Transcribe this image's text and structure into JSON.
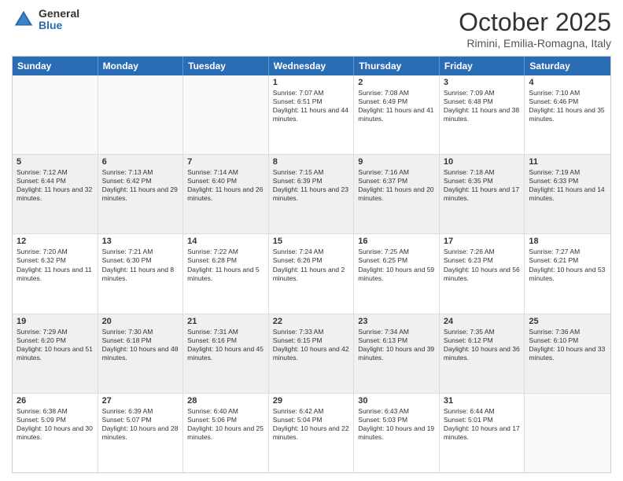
{
  "logo": {
    "general": "General",
    "blue": "Blue"
  },
  "header": {
    "month": "October 2025",
    "location": "Rimini, Emilia-Romagna, Italy"
  },
  "days": [
    "Sunday",
    "Monday",
    "Tuesday",
    "Wednesday",
    "Thursday",
    "Friday",
    "Saturday"
  ],
  "weeks": [
    [
      {
        "day": "",
        "content": ""
      },
      {
        "day": "",
        "content": ""
      },
      {
        "day": "",
        "content": ""
      },
      {
        "day": "1",
        "content": "Sunrise: 7:07 AM\nSunset: 6:51 PM\nDaylight: 11 hours and 44 minutes."
      },
      {
        "day": "2",
        "content": "Sunrise: 7:08 AM\nSunset: 6:49 PM\nDaylight: 11 hours and 41 minutes."
      },
      {
        "day": "3",
        "content": "Sunrise: 7:09 AM\nSunset: 6:48 PM\nDaylight: 11 hours and 38 minutes."
      },
      {
        "day": "4",
        "content": "Sunrise: 7:10 AM\nSunset: 6:46 PM\nDaylight: 11 hours and 35 minutes."
      }
    ],
    [
      {
        "day": "5",
        "content": "Sunrise: 7:12 AM\nSunset: 6:44 PM\nDaylight: 11 hours and 32 minutes."
      },
      {
        "day": "6",
        "content": "Sunrise: 7:13 AM\nSunset: 6:42 PM\nDaylight: 11 hours and 29 minutes."
      },
      {
        "day": "7",
        "content": "Sunrise: 7:14 AM\nSunset: 6:40 PM\nDaylight: 11 hours and 26 minutes."
      },
      {
        "day": "8",
        "content": "Sunrise: 7:15 AM\nSunset: 6:39 PM\nDaylight: 11 hours and 23 minutes."
      },
      {
        "day": "9",
        "content": "Sunrise: 7:16 AM\nSunset: 6:37 PM\nDaylight: 11 hours and 20 minutes."
      },
      {
        "day": "10",
        "content": "Sunrise: 7:18 AM\nSunset: 6:35 PM\nDaylight: 11 hours and 17 minutes."
      },
      {
        "day": "11",
        "content": "Sunrise: 7:19 AM\nSunset: 6:33 PM\nDaylight: 11 hours and 14 minutes."
      }
    ],
    [
      {
        "day": "12",
        "content": "Sunrise: 7:20 AM\nSunset: 6:32 PM\nDaylight: 11 hours and 11 minutes."
      },
      {
        "day": "13",
        "content": "Sunrise: 7:21 AM\nSunset: 6:30 PM\nDaylight: 11 hours and 8 minutes."
      },
      {
        "day": "14",
        "content": "Sunrise: 7:22 AM\nSunset: 6:28 PM\nDaylight: 11 hours and 5 minutes."
      },
      {
        "day": "15",
        "content": "Sunrise: 7:24 AM\nSunset: 6:26 PM\nDaylight: 11 hours and 2 minutes."
      },
      {
        "day": "16",
        "content": "Sunrise: 7:25 AM\nSunset: 6:25 PM\nDaylight: 10 hours and 59 minutes."
      },
      {
        "day": "17",
        "content": "Sunrise: 7:26 AM\nSunset: 6:23 PM\nDaylight: 10 hours and 56 minutes."
      },
      {
        "day": "18",
        "content": "Sunrise: 7:27 AM\nSunset: 6:21 PM\nDaylight: 10 hours and 53 minutes."
      }
    ],
    [
      {
        "day": "19",
        "content": "Sunrise: 7:29 AM\nSunset: 6:20 PM\nDaylight: 10 hours and 51 minutes."
      },
      {
        "day": "20",
        "content": "Sunrise: 7:30 AM\nSunset: 6:18 PM\nDaylight: 10 hours and 48 minutes."
      },
      {
        "day": "21",
        "content": "Sunrise: 7:31 AM\nSunset: 6:16 PM\nDaylight: 10 hours and 45 minutes."
      },
      {
        "day": "22",
        "content": "Sunrise: 7:33 AM\nSunset: 6:15 PM\nDaylight: 10 hours and 42 minutes."
      },
      {
        "day": "23",
        "content": "Sunrise: 7:34 AM\nSunset: 6:13 PM\nDaylight: 10 hours and 39 minutes."
      },
      {
        "day": "24",
        "content": "Sunrise: 7:35 AM\nSunset: 6:12 PM\nDaylight: 10 hours and 36 minutes."
      },
      {
        "day": "25",
        "content": "Sunrise: 7:36 AM\nSunset: 6:10 PM\nDaylight: 10 hours and 33 minutes."
      }
    ],
    [
      {
        "day": "26",
        "content": "Sunrise: 6:38 AM\nSunset: 5:09 PM\nDaylight: 10 hours and 30 minutes."
      },
      {
        "day": "27",
        "content": "Sunrise: 6:39 AM\nSunset: 5:07 PM\nDaylight: 10 hours and 28 minutes."
      },
      {
        "day": "28",
        "content": "Sunrise: 6:40 AM\nSunset: 5:06 PM\nDaylight: 10 hours and 25 minutes."
      },
      {
        "day": "29",
        "content": "Sunrise: 6:42 AM\nSunset: 5:04 PM\nDaylight: 10 hours and 22 minutes."
      },
      {
        "day": "30",
        "content": "Sunrise: 6:43 AM\nSunset: 5:03 PM\nDaylight: 10 hours and 19 minutes."
      },
      {
        "day": "31",
        "content": "Sunrise: 6:44 AM\nSunset: 5:01 PM\nDaylight: 10 hours and 17 minutes."
      },
      {
        "day": "",
        "content": ""
      }
    ]
  ]
}
